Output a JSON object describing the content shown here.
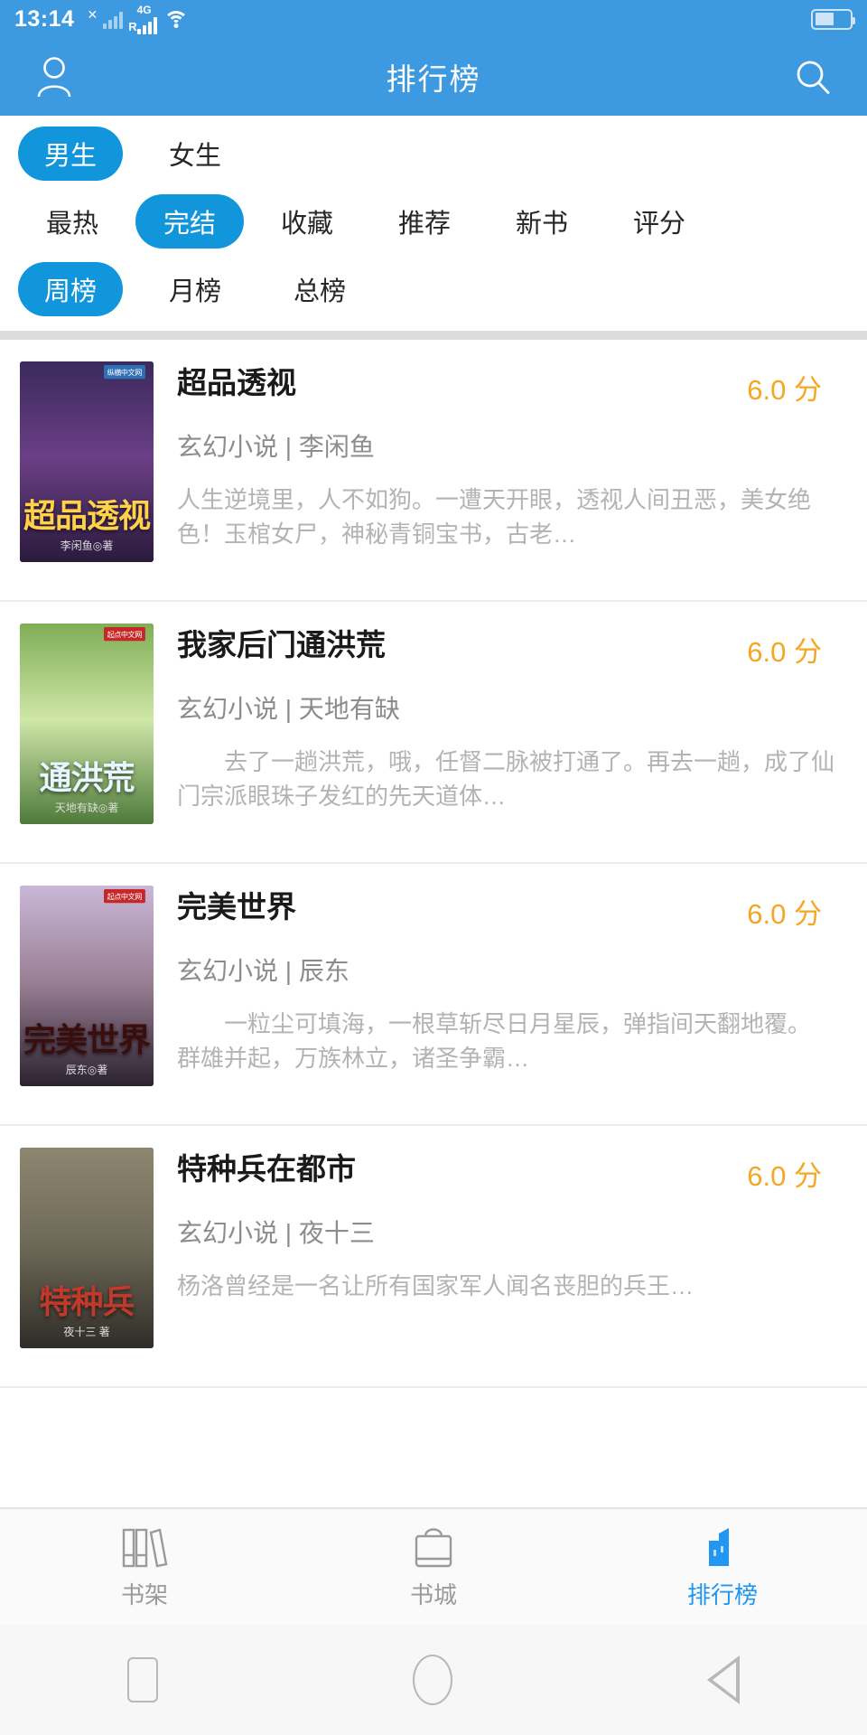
{
  "status_bar": {
    "time": "13:14",
    "network_label": "R",
    "network_type": "4G",
    "icons": [
      "close-x-icon",
      "signal-bars-icon",
      "signal-bars-4g-icon",
      "wifi-icon",
      "battery-icon"
    ],
    "battery_level_percent": 55
  },
  "app_bar": {
    "title": "排行榜",
    "profile_icon": "user-icon",
    "search_icon": "search-icon"
  },
  "filters": {
    "gender": {
      "active": "男生",
      "options": [
        "男生",
        "女生"
      ]
    },
    "category": {
      "active": "完结",
      "options": [
        "最热",
        "完结",
        "收藏",
        "推荐",
        "新书",
        "评分"
      ]
    },
    "period": {
      "active": "周榜",
      "options": [
        "周榜",
        "月榜",
        "总榜"
      ]
    }
  },
  "books": [
    {
      "title": "超品透视",
      "genre": "玄幻小说",
      "author": "李闲鱼",
      "meta": "玄幻小说 | 李闲鱼",
      "score": "6.0 分",
      "description": "人生逆境里，人不如狗。一遭天开眼，透视人间丑恶，美女绝色！玉棺女尸，神秘青铜宝书，古老…",
      "cover": {
        "badge": "纵横中文网",
        "badge_color": "#2f6fb5",
        "title_text": "超品透视",
        "title_color": "#ffd24a",
        "author_line": "李闲鱼◎著",
        "bg_top": "#3b2a5c",
        "bg_mid": "#6b3f86",
        "bg_bottom": "#2a1b3d"
      }
    },
    {
      "title": "我家后门通洪荒",
      "genre": "玄幻小说",
      "author": "天地有缺",
      "meta": "玄幻小说 | 天地有缺",
      "score": "6.0 分",
      "description": "　　去了一趟洪荒，哦，任督二脉被打通了。再去一趟，成了仙门宗派眼珠子发红的先天道体…",
      "cover": {
        "badge": "起点中文网",
        "badge_color": "#c62828",
        "title_text": "通洪荒",
        "title_color": "#e8f6ff",
        "author_line": "天地有缺◎著",
        "bg_top": "#7fae55",
        "bg_mid": "#cfe6a8",
        "bg_bottom": "#4e7a3a"
      }
    },
    {
      "title": "完美世界",
      "genre": "玄幻小说",
      "author": "辰东",
      "meta": "玄幻小说 | 辰东",
      "score": "6.0 分",
      "description": "　　一粒尘可填海，一根草斩尽日月星辰，弹指间天翻地覆。　　群雄并起，万族林立，诸圣争霸…",
      "cover": {
        "badge": "起点中文网",
        "badge_color": "#c62828",
        "title_text": "完美世界",
        "title_color": "#3b0d0d",
        "author_line": "辰东◎著",
        "bg_top": "#c9b8d8",
        "bg_mid": "#9a7f94",
        "bg_bottom": "#2b2230"
      }
    },
    {
      "title": "特种兵在都市",
      "genre": "玄幻小说",
      "author": "夜十三",
      "meta": "玄幻小说 | 夜十三",
      "score": "6.0 分",
      "description": "杨洛曾经是一名让所有国家军人闻名丧胆的兵王…",
      "cover": {
        "badge": "",
        "badge_color": "#8a8a8a",
        "title_text": "特种兵",
        "title_color": "#c0392b",
        "author_line": "夜十三 著",
        "bg_top": "#8d8670",
        "bg_mid": "#6e6a58",
        "bg_bottom": "#2f2d28"
      }
    }
  ],
  "bottom_tabs": [
    {
      "label": "书架",
      "icon": "bookshelf-icon",
      "active": false
    },
    {
      "label": "书城",
      "icon": "bookstore-bag-icon",
      "active": false
    },
    {
      "label": "排行榜",
      "icon": "ranking-chart-icon",
      "active": true
    }
  ],
  "system_nav": {
    "recents": "square-recents-icon",
    "home": "circle-home-icon",
    "back": "triangle-back-icon"
  },
  "colors": {
    "header_blue": "#3d9ae0",
    "pill_blue": "#1296db",
    "score_orange": "#f5a623",
    "active_tab_blue": "#2196f3",
    "divider_gray": "#dcdcdc"
  }
}
